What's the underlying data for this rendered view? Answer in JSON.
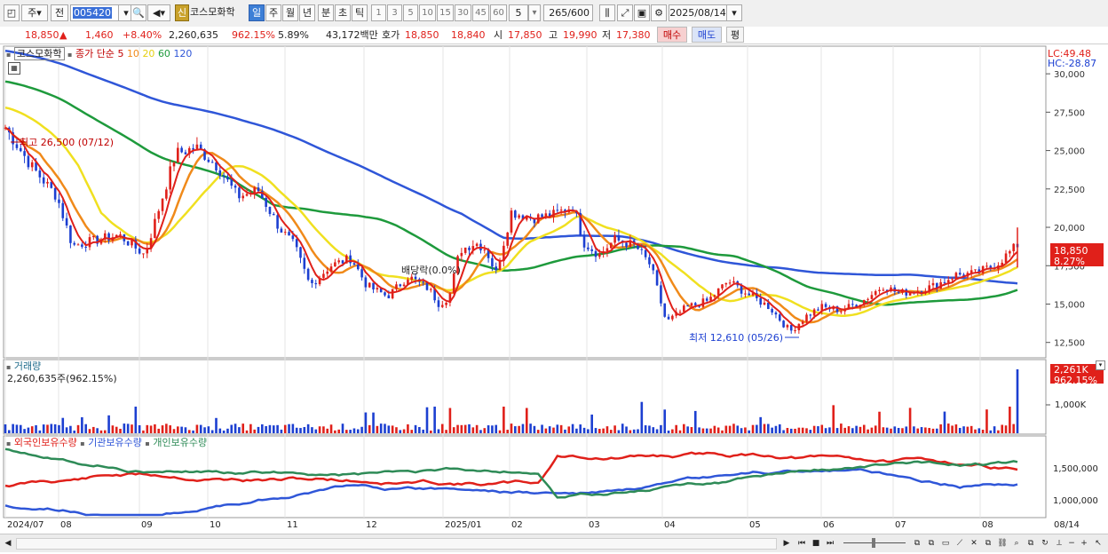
{
  "toolbar": {
    "period_btn": "주",
    "prev_btn": "전",
    "stock_code": "005420",
    "stock_name": "코스모화학",
    "new_tag": "신",
    "timeframes": [
      "일",
      "주",
      "월",
      "년",
      "분",
      "초",
      "틱"
    ],
    "active_timeframe": "일",
    "intervals": [
      "1",
      "3",
      "5",
      "10",
      "15",
      "30",
      "45",
      "60"
    ],
    "interval_value": "5",
    "count_display": "265/600",
    "date": "2025/08/14"
  },
  "quote": {
    "price": "18,850",
    "change_arrow": "▲",
    "change": "1,460",
    "change_pct": "+8.40%",
    "volume": "2,260,635",
    "volume_ratio": "962.15%",
    "turnover_pct": "5.89%",
    "trade_value": "43,172백만",
    "bid_label": "호가",
    "bid1": "18,850",
    "bid2": "18,840",
    "open_label": "시",
    "open": "17,850",
    "high_label": "고",
    "high": "19,990",
    "low_label": "저",
    "low": "17,380",
    "buy_btn": "매수",
    "sell_btn": "매도",
    "eval_btn": "평"
  },
  "price_panel": {
    "title": "코스모화학",
    "ma_label": "종가 단순",
    "ma_periods": [
      "5",
      "10",
      "20",
      "60",
      "120"
    ],
    "ma_colors": [
      "#e0201a",
      "#f08a1a",
      "#f0e020",
      "#1e9a3c",
      "#2f56d8"
    ],
    "lc": "LC:49.48",
    "hc": "HC:-28.87",
    "high_annotation": "최고 26,500 (07/12)",
    "low_annotation": "최저 12,610 (05/26)",
    "dividend_annotation": "배당락(0.0%)",
    "current_price_tag": "18,850",
    "current_pct_tag": "8.27%",
    "y_ticks": [
      "30,000",
      "27,500",
      "25,000",
      "22,500",
      "20,000",
      "17,500",
      "15,000",
      "12,500"
    ]
  },
  "volume_panel": {
    "title": "거래량",
    "value_text": "2,260,635주(962.15%)",
    "tag_value": "2,261K",
    "tag_pct": "962.15%",
    "y_ticks": [
      "1,000K"
    ]
  },
  "holding_panel": {
    "series": [
      {
        "name": "외국인보유수량",
        "color": "#e0201a"
      },
      {
        "name": "기관보유수량",
        "color": "#2f56d8"
      },
      {
        "name": "개인보유수량",
        "color": "#2e8b57"
      }
    ],
    "y_ticks": [
      "1,500,000",
      "1,000,000"
    ]
  },
  "x_axis": {
    "labels": [
      "2024/07",
      "08",
      "09",
      "10",
      "11",
      "12",
      "2025/01",
      "02",
      "03",
      "04",
      "05",
      "06",
      "07",
      "08"
    ],
    "end_label": "08/14"
  },
  "chart_data": {
    "type": "line",
    "ylim": [
      11500,
      31800
    ],
    "price_points": [
      [
        0,
        26500
      ],
      [
        0.05,
        24000
      ],
      [
        0.1,
        22000
      ],
      [
        0.13,
        18800
      ],
      [
        0.18,
        19200
      ],
      [
        0.22,
        19500
      ],
      [
        0.27,
        18200
      ],
      [
        0.3,
        21500
      ],
      [
        0.33,
        24800
      ],
      [
        0.37,
        25200
      ],
      [
        0.41,
        24000
      ],
      [
        0.45,
        22000
      ],
      [
        0.49,
        22400
      ],
      [
        0.53,
        20000
      ],
      [
        0.56,
        18800
      ],
      [
        0.59,
        16200
      ],
      [
        0.63,
        17500
      ],
      [
        0.67,
        18000
      ],
      [
        0.7,
        16200
      ],
      [
        0.74,
        15500
      ],
      [
        0.78,
        16800
      ],
      [
        0.82,
        16000
      ],
      [
        0.84,
        15000
      ],
      [
        0.86,
        15500
      ],
      [
        0.88,
        18500
      ],
      [
        0.91,
        19000
      ],
      [
        0.93,
        18600
      ],
      [
        0.95,
        17000
      ],
      [
        0.98,
        21000
      ],
      [
        1.02,
        20600
      ],
      [
        1.06,
        20800
      ],
      [
        1.1,
        21400
      ],
      [
        1.12,
        19000
      ],
      [
        1.15,
        18200
      ],
      [
        1.18,
        19200
      ],
      [
        1.22,
        18800
      ],
      [
        1.25,
        17500
      ],
      [
        1.28,
        13800
      ],
      [
        1.32,
        14800
      ],
      [
        1.36,
        15200
      ],
      [
        1.4,
        16500
      ],
      [
        1.44,
        15600
      ],
      [
        1.48,
        14800
      ],
      [
        1.52,
        13200
      ],
      [
        1.55,
        14200
      ],
      [
        1.58,
        14800
      ],
      [
        1.62,
        14600
      ],
      [
        1.66,
        15200
      ],
      [
        1.7,
        16200
      ],
      [
        1.73,
        15700
      ],
      [
        1.77,
        15900
      ],
      [
        1.8,
        16200
      ],
      [
        1.84,
        16900
      ],
      [
        1.88,
        17000
      ],
      [
        1.92,
        17600
      ],
      [
        1.96,
        18850
      ]
    ]
  }
}
